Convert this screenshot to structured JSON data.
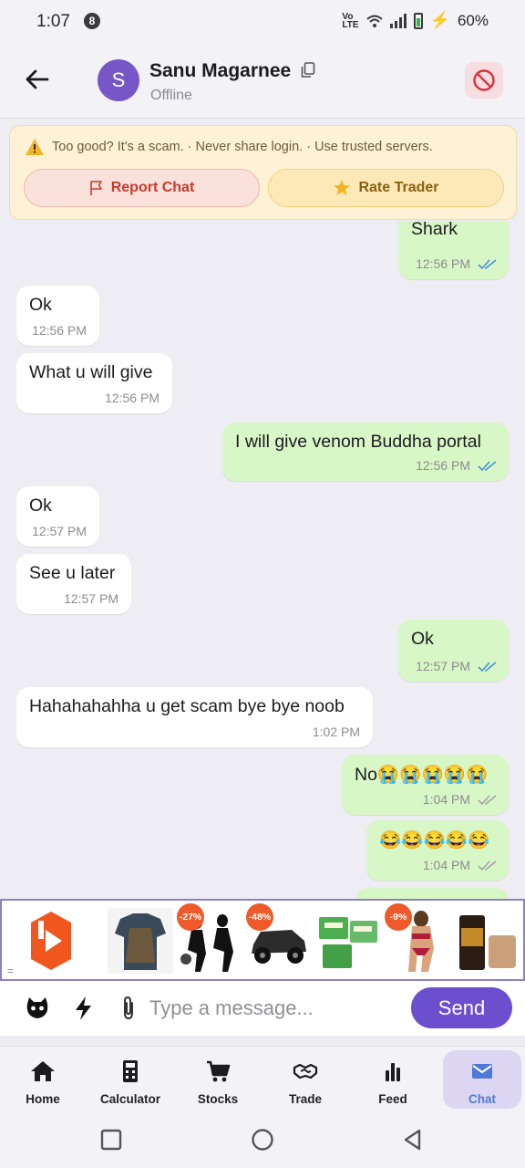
{
  "status_bar": {
    "time": "1:07",
    "badge": "8",
    "network": "VoLTE",
    "battery": "60%"
  },
  "header": {
    "avatar_initial": "S",
    "contact_name": "Sanu Magarnee",
    "contact_status": "Offline"
  },
  "warning": {
    "text": "Too good? It's a scam. · Never share login. · Use trusted servers.",
    "report_label": "Report Chat",
    "rate_label": "Rate Trader"
  },
  "messages": [
    {
      "side": "out",
      "text": "Shark",
      "time": "12:56 PM",
      "read": true
    },
    {
      "side": "in",
      "text": "Ok",
      "time": "12:56 PM"
    },
    {
      "side": "in",
      "text": "What u will give",
      "time": "12:56 PM"
    },
    {
      "side": "out",
      "text": "I will give venom Buddha portal",
      "time": "12:56 PM",
      "read": true
    },
    {
      "side": "in",
      "text": "Ok",
      "time": "12:57 PM"
    },
    {
      "side": "in",
      "text": "See u later",
      "time": "12:57 PM"
    },
    {
      "side": "out",
      "text": "Ok",
      "time": "12:57 PM",
      "read": true
    },
    {
      "side": "in",
      "text": "Hahahahahha u get scam bye bye noob",
      "time": "1:02 PM"
    },
    {
      "side": "out",
      "text": "No😭😭😭😭😭",
      "time": "1:04 PM",
      "read": false
    },
    {
      "side": "out",
      "text": "😂😂😂😂😂",
      "time": "1:04 PM",
      "read": false
    }
  ],
  "ad": {
    "discounts": [
      "-27%",
      "-48%",
      "-9%"
    ],
    "handle": "="
  },
  "composer": {
    "placeholder": "Type a message...",
    "send_label": "Send"
  },
  "bottom_nav": [
    {
      "label": "Home",
      "icon": "home-icon"
    },
    {
      "label": "Calculator",
      "icon": "calculator-icon"
    },
    {
      "label": "Stocks",
      "icon": "cart-icon"
    },
    {
      "label": "Trade",
      "icon": "handshake-icon"
    },
    {
      "label": "Feed",
      "icon": "bar-chart-icon"
    },
    {
      "label": "Chat",
      "icon": "chat-icon",
      "active": true
    }
  ],
  "colors": {
    "accent": "#6b4fce",
    "outgoing": "#d8f7c6",
    "incoming": "#ffffff",
    "read_tick": "#4a90d9"
  }
}
